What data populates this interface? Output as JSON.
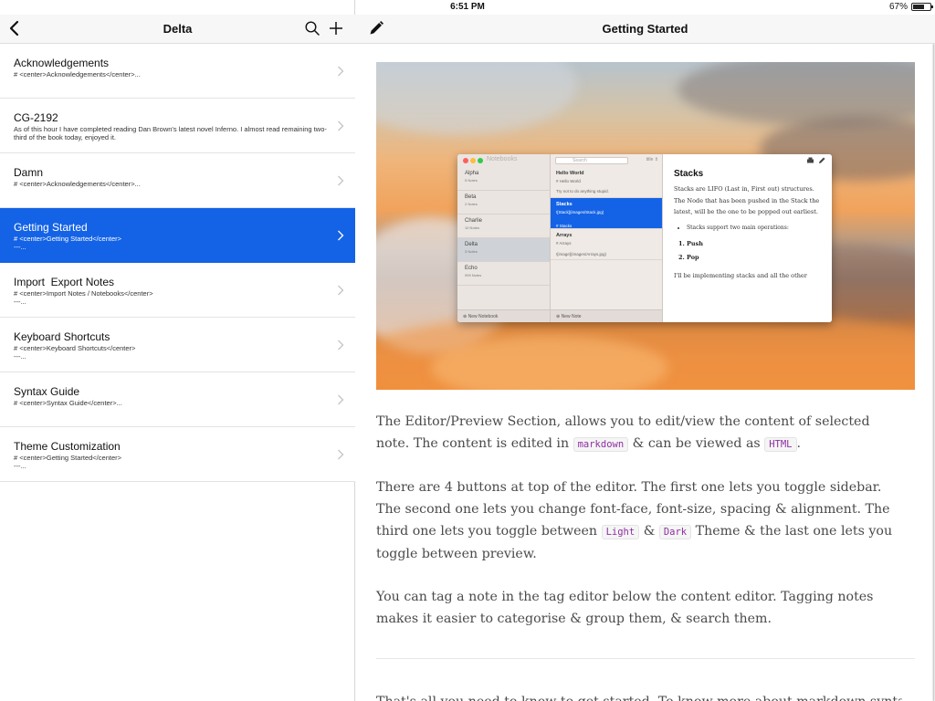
{
  "status_bar": {
    "device": "iPad",
    "time": "6:51 PM",
    "battery": "67%",
    "battery_level": 0.67
  },
  "sidebar": {
    "title": "Delta",
    "notes": [
      {
        "title": "Acknowledgements",
        "preview": "# <center>Acknowledgements</center>..."
      },
      {
        "title": "CG-2192",
        "preview": "As of this hour I have completed reading Dan Brown's latest novel Inferno. I almost read remaining two-third of the book today, enjoyed it."
      },
      {
        "title": "Damn",
        "preview": "# <center>Acknowledgements</center>..."
      },
      {
        "title": "Getting Started",
        "preview": "# <center>Getting Started</center>\n---..."
      },
      {
        "title": "Import  Export Notes",
        "preview": "# <center>Import Notes / Notebooks</center>\n---..."
      },
      {
        "title": "Keyboard Shortcuts",
        "preview": "# <center>Keyboard Shortcuts</center>\n---..."
      },
      {
        "title": "Syntax Guide",
        "preview": "# <center>Syntax Guide</center>..."
      },
      {
        "title": "Theme Customization",
        "preview": "# <center>Getting Started</center>\n---..."
      }
    ],
    "selected_index": 3
  },
  "main": {
    "title": "Getting Started",
    "preview_app": {
      "app_name": "Notebooks",
      "search_placeholder": "Search",
      "sort_label": "title",
      "notebooks": [
        {
          "name": "Alpha",
          "count": "5 Notes"
        },
        {
          "name": "Beta",
          "count": "2 Notes"
        },
        {
          "name": "Charlie",
          "count": "10 Notes"
        },
        {
          "name": "Delta",
          "count": "3 Notes"
        },
        {
          "name": "Echo",
          "count": "999 Notes"
        }
      ],
      "new_notebook": "New Notebook",
      "notes": [
        {
          "title": "Hello World",
          "preview": "# Hello World",
          "extra": "Try not to do anything stupid."
        },
        {
          "title": "Stacks",
          "preview": "![Stack](images/Stack.jpg)",
          "extra": "# Stacks"
        },
        {
          "title": "Arrays",
          "preview": "# Arrays",
          "extra": "![image](images/Arrays.jpg)"
        }
      ],
      "new_note": "New Note",
      "doc": {
        "heading": "Stacks",
        "para": "Stacks are LIFO (Last in, First out) structures. The Node that has been pushed in the Stack the latest, will be the one to be popped out earliest.",
        "bullet": "Stacks support two main operations:",
        "ops": [
          "Push",
          "Pop"
        ],
        "tail": "I'll be implementing stacks and all the other"
      }
    },
    "paragraphs": {
      "p1_a": "The Editor/Preview Section, allows you to edit/view the content of selected note. The content is edited in ",
      "p1_code1": "markdown",
      "p1_b": " & can be viewed as ",
      "p1_code2": "HTML",
      "p1_c": ".",
      "p2_a": "There are 4 buttons at top of the editor. The first one lets you toggle sidebar. The second one lets you change font-face, font-size, spacing & alignment. The third one lets you toggle between ",
      "p2_code1": "Light",
      "p2_b": " & ",
      "p2_code2": "Dark",
      "p2_c": " Theme & the last one lets you toggle between preview.",
      "p3": "You can tag a note in the tag editor below the content editor. Tagging notes makes it easier to categorise & group them, & search them.",
      "p4": "That's all you need to know to get started. To know more about markdown syntax &"
    }
  },
  "colors": {
    "selection": "#1463e6",
    "code_text": "#8e2fa1"
  },
  "icons": [
    "wifi-icon",
    "battery-icon",
    "back-chevron-icon",
    "search-icon",
    "plus-icon",
    "chevron-right-icon",
    "pencil-icon",
    "print-icon",
    "edit-icon"
  ]
}
